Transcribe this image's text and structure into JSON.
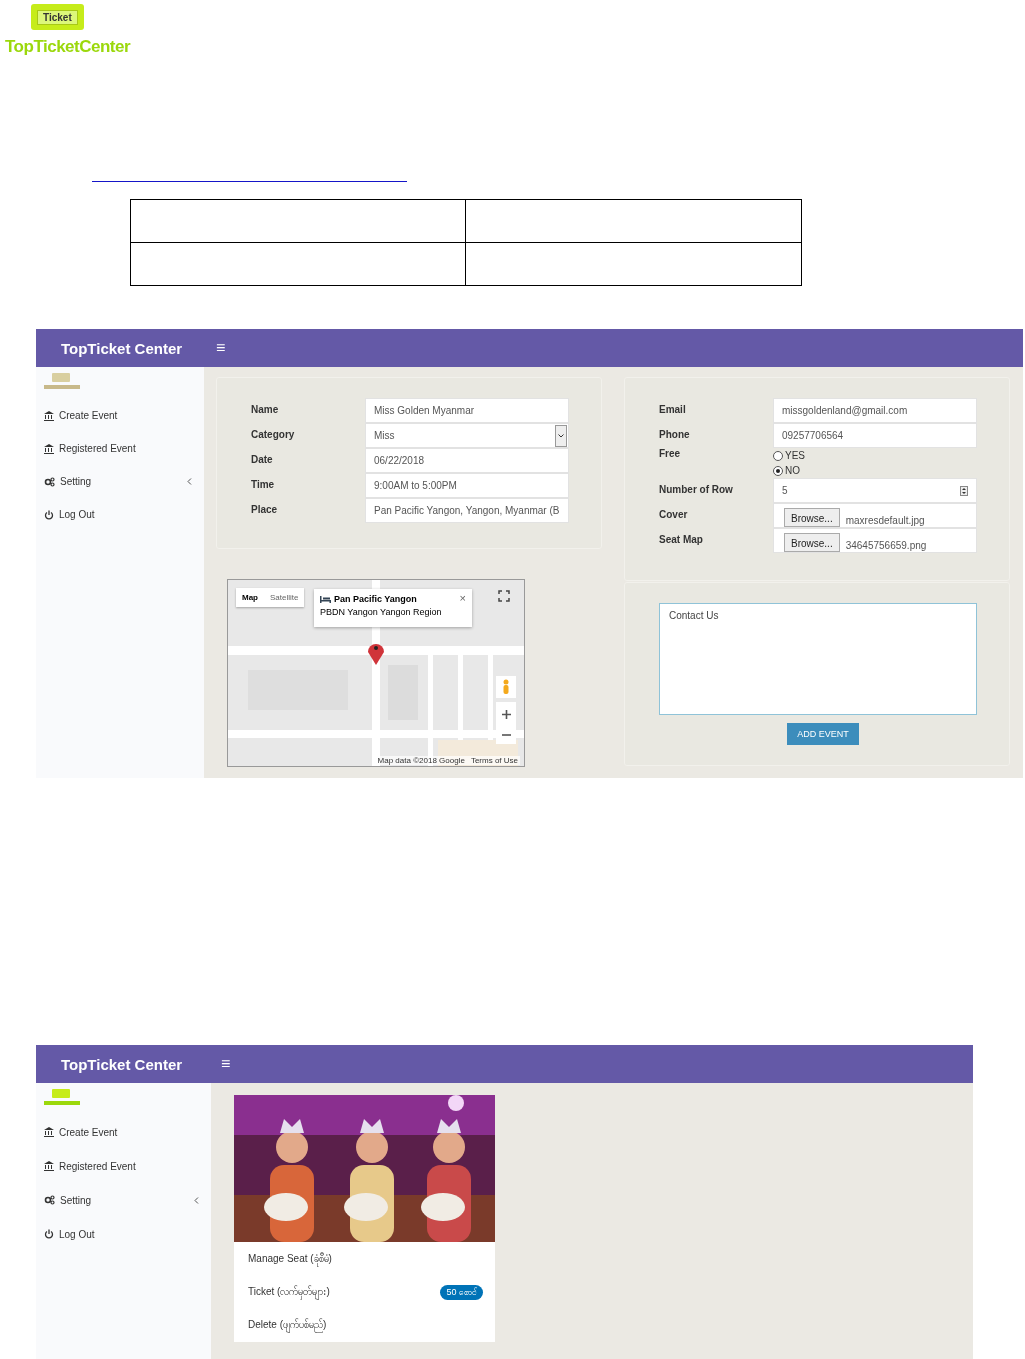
{
  "logo": {
    "badge": "Ticket",
    "wordmark": "TopTicketCenter"
  },
  "event_form_screen": {
    "header": {
      "title": "TopTicket Center",
      "menu": "≡"
    },
    "sidebar": [
      {
        "label": "Create Event",
        "kind": "link"
      },
      {
        "label": "Registered Event",
        "kind": "link"
      },
      {
        "label": "Setting",
        "kind": "submenu"
      },
      {
        "label": "Log Out",
        "kind": "link"
      }
    ],
    "details": [
      {
        "label": "Name",
        "kind": "text",
        "value": "Miss Golden Myanmar"
      },
      {
        "label": "Category",
        "kind": "select",
        "value": "Miss"
      },
      {
        "label": "Date",
        "kind": "text",
        "value": "06/22/2018"
      },
      {
        "label": "Time",
        "kind": "text",
        "value": "9:00AM to 5:00PM"
      },
      {
        "label": "Place",
        "kind": "text",
        "value": "Pan Pacific Yangon, Yangon, Myanmar (B"
      }
    ],
    "contact": [
      {
        "label": "Email",
        "kind": "text",
        "value": "missgoldenland@gmail.com"
      },
      {
        "label": "Phone",
        "kind": "text",
        "value": "09257706564"
      },
      {
        "label": "Free",
        "kind": "radio",
        "options": [
          {
            "label": "YES",
            "selected": false
          },
          {
            "label": "NO",
            "selected": true
          }
        ]
      },
      {
        "label": "Number of Row",
        "kind": "number",
        "value": "5"
      },
      {
        "label": "Cover",
        "kind": "file",
        "button": "Browse...",
        "value": "maxresdefault.jpg"
      },
      {
        "label": "Seat Map",
        "kind": "file",
        "button": "Browse...",
        "value": "34645756659.png"
      }
    ],
    "map": {
      "kind": "picture",
      "types": [
        {
          "label": "Map",
          "selected": true
        },
        {
          "label": "Satellite",
          "selected": false
        }
      ],
      "info_title": "Pan Pacific Yangon",
      "info_address": "PBDN Yangon Yangon Region",
      "close": "×",
      "attribution": [
        "Map data ©2018 Google",
        "Terms of Use"
      ]
    },
    "message": {
      "value": "Contact Us"
    },
    "submit": "ADD EVENT"
  },
  "event_card_screen": {
    "header": {
      "title": "TopTicket Center",
      "menu": "≡"
    },
    "sidebar": [
      {
        "label": "Create Event",
        "kind": "link"
      },
      {
        "label": "Registered Event",
        "kind": "link"
      },
      {
        "label": "Setting",
        "kind": "submenu"
      },
      {
        "label": "Log Out",
        "kind": "link"
      }
    ],
    "card": {
      "actions": [
        {
          "label": "Manage Seat (ခုံစီမံ)"
        },
        {
          "label": "Ticket (လက်မှတ်များ)",
          "badge": "50 စောင်"
        },
        {
          "label": "Delete (ဖျက်ပစ်မည်)"
        }
      ]
    }
  }
}
